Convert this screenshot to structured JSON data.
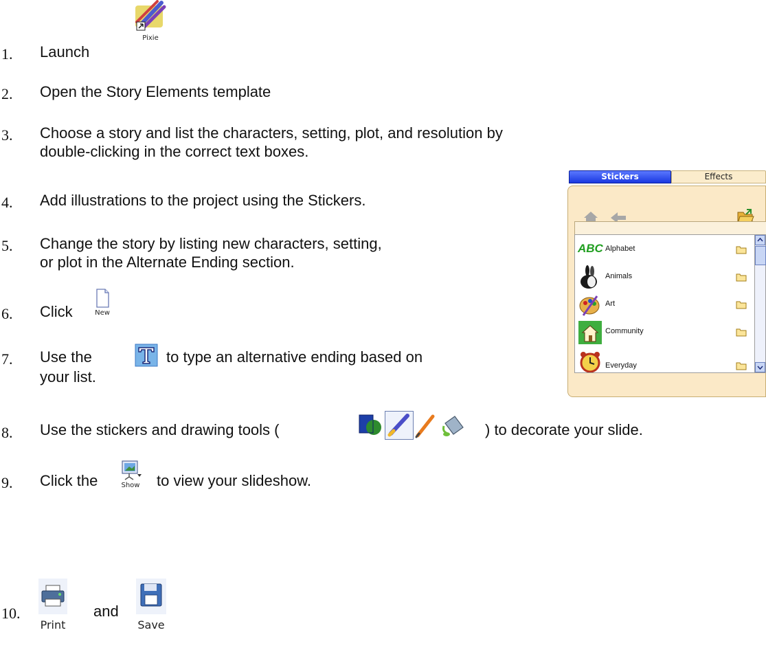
{
  "steps": [
    {
      "num": "1.",
      "lines": [
        "Launch"
      ]
    },
    {
      "num": "2.",
      "lines": [
        " Open the Story Elements template"
      ]
    },
    {
      "num": "3.",
      "lines": [
        "Choose a story and list the characters, setting, plot, and resolution  by",
        "double-clicking in the correct text boxes."
      ]
    },
    {
      "num": "4.",
      "lines": [
        "Add illustrations to the project using the Stickers."
      ]
    },
    {
      "num": "5.",
      "lines": [
        "Change the story by listing new characters, setting,",
        "or plot in the Alternate Ending section."
      ]
    },
    {
      "num": "6.",
      "lines": [
        "Click"
      ]
    },
    {
      "num": "7.",
      "pre": "Use the",
      "post": "to type an alternative ending based on",
      "line2": "your list."
    },
    {
      "num": "8.",
      "pre": "Use the stickers and drawing tools (",
      "post": ")  to decorate your slide."
    },
    {
      "num": "9.",
      "pre": "Click the",
      "post": "to view your slideshow."
    },
    {
      "num": "10.",
      "and": "and"
    }
  ],
  "icons": {
    "pixie": {
      "caption": "Pixie",
      "name": "pixie-brush-icon"
    },
    "new": {
      "caption": "New",
      "name": "new-document-icon"
    },
    "text_tool": {
      "name": "text-tool-icon"
    },
    "show": {
      "caption": "Show",
      "name": "slideshow-icon"
    },
    "print": {
      "caption": "Print",
      "name": "printer-icon"
    },
    "save": {
      "caption": "Save",
      "name": "floppy-disk-icon"
    }
  },
  "stickers_panel": {
    "tabs": [
      "Stickers",
      "Effects"
    ],
    "items": [
      "Alphabet",
      "Animals",
      "Art",
      "Community",
      "Everyday"
    ],
    "alphabet_icon_text": "ABC"
  },
  "colors": {
    "tab_active": "#1a38e0",
    "panel_bg": "#fbe9c7"
  }
}
